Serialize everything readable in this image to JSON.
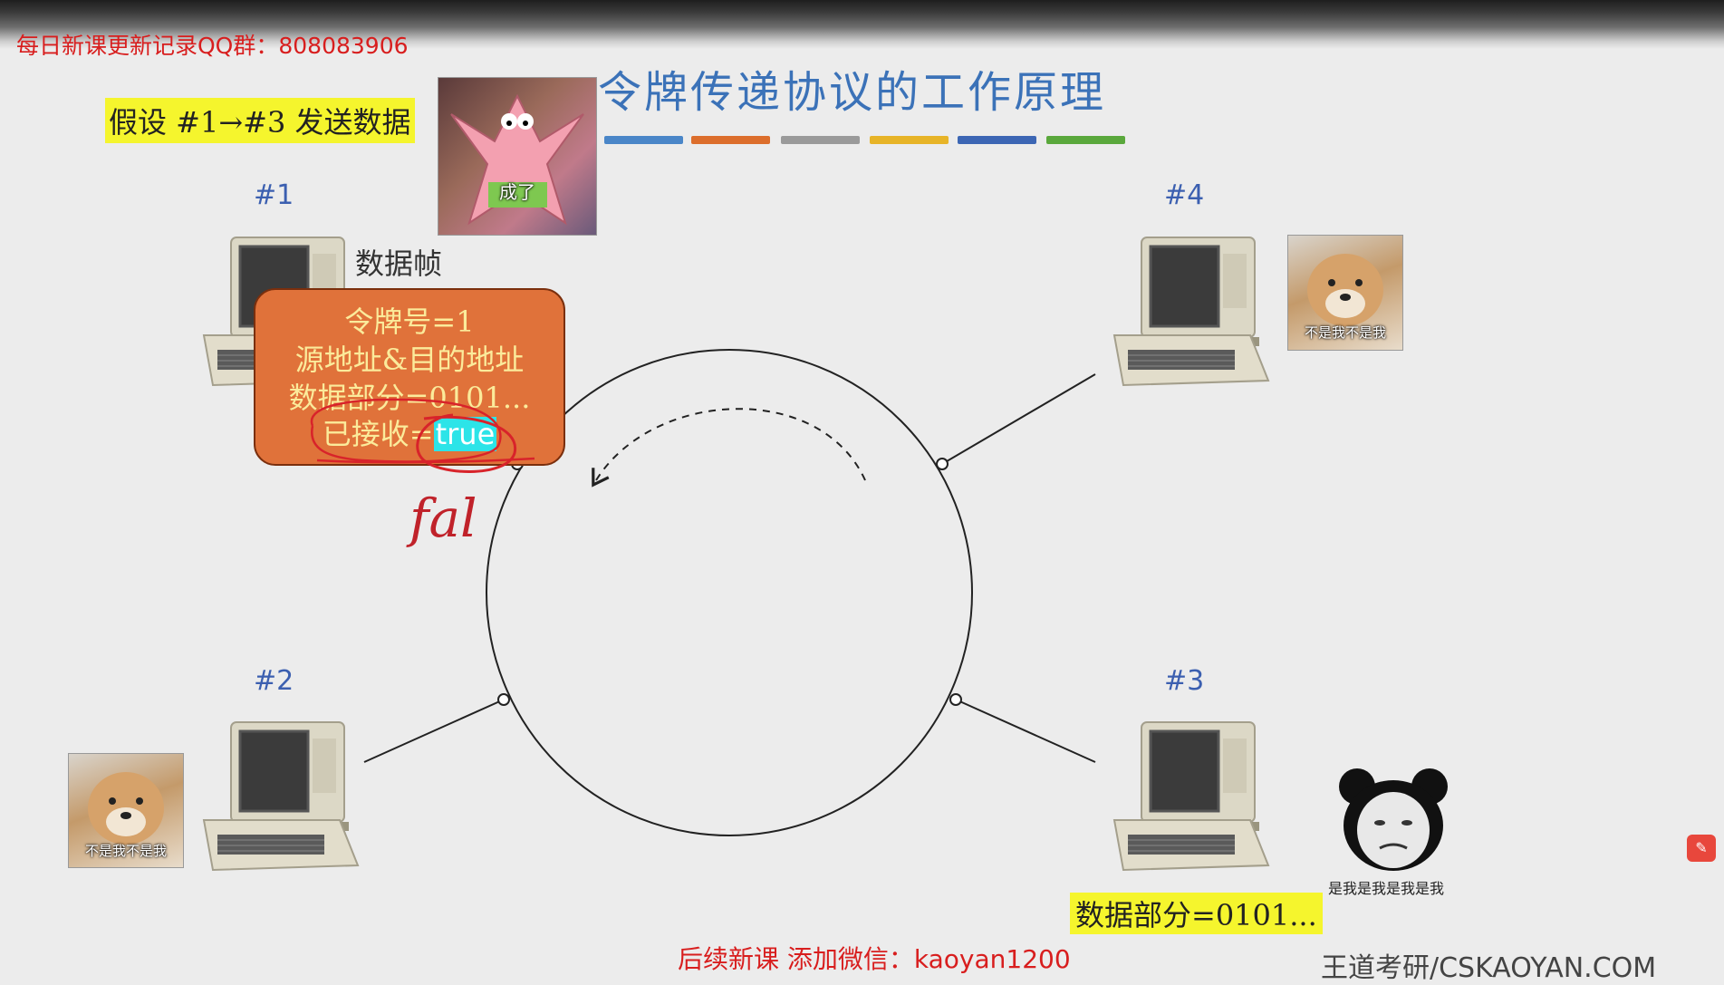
{
  "watermark_top": "每日新课更新记录QQ群：808083906",
  "title": "令牌传递协议的工作原理",
  "assumption": "假设 #1→#3 发送数据",
  "accent_colors": [
    "#4a86c8",
    "#dc6e2c",
    "#9a9a9a",
    "#e7b428",
    "#3c66b4",
    "#5aa83c"
  ],
  "hosts": {
    "h1": "#1",
    "h2": "#2",
    "h3": "#3",
    "h4": "#4"
  },
  "frame": {
    "label": "数据帧",
    "token": "令牌号=1",
    "addresses": "源地址&目的地址",
    "data": "数据部分=0101...",
    "received_prefix": "已接收=",
    "received_value": "true"
  },
  "handwriting": "fal",
  "memes": {
    "patrick_caption": "成了",
    "doge_caption": "不是我不是我",
    "panda_caption": "是我是我是我是我"
  },
  "host3_data": "数据部分=0101...",
  "bottom_watermark": "后续新课 添加微信：kaoyan1200",
  "brand": "王道考研/CSKAOYAN.COM",
  "side_button_icon": "annotation-icon"
}
